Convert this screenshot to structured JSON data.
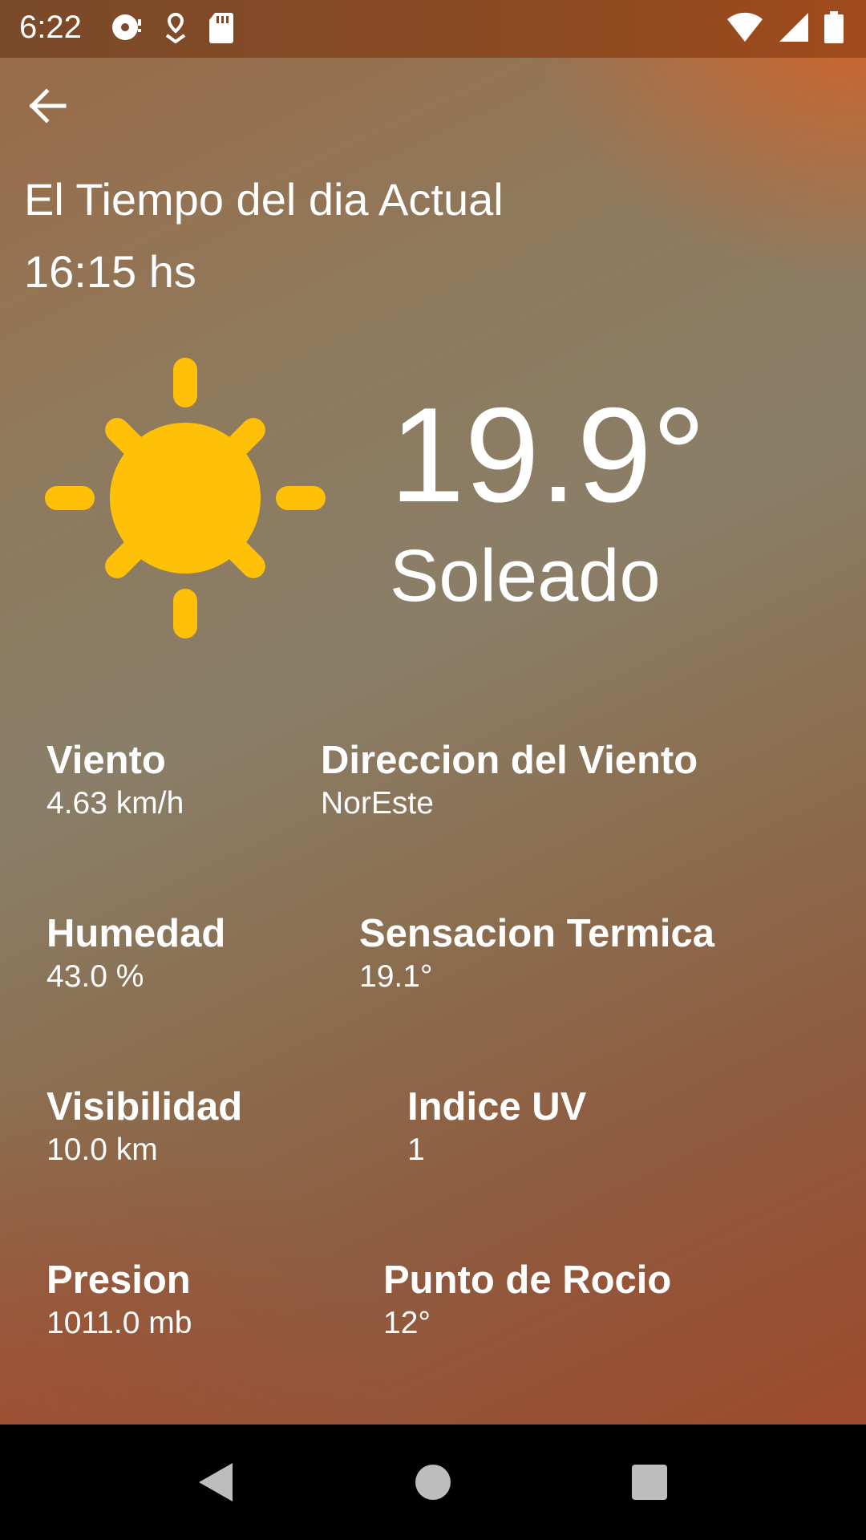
{
  "status_bar": {
    "time": "6:22",
    "left_icons": [
      "disc-icon",
      "location-pin-icon",
      "sd-card-icon"
    ],
    "right_icons": [
      "wifi-icon",
      "signal-icon",
      "battery-icon"
    ]
  },
  "header": {
    "title": "El Tiempo del dia Actual",
    "time": "16:15 hs"
  },
  "current": {
    "icon": "sun-icon",
    "temperature": "19.9°",
    "condition": "Soleado"
  },
  "stats": [
    {
      "label": "Viento",
      "value": "4.63 km/h"
    },
    {
      "label": "Direccion del Viento",
      "value": "NorEste"
    },
    {
      "label": "Humedad",
      "value": "43.0 %"
    },
    {
      "label": "Sensacion Termica",
      "value": "19.1°"
    },
    {
      "label": "Visibilidad",
      "value": "10.0 km"
    },
    {
      "label": "Indice UV",
      "value": "1"
    },
    {
      "label": "Presion",
      "value": "1011.0 mb"
    },
    {
      "label": "Punto de Rocio",
      "value": "12°"
    }
  ],
  "colors": {
    "sun": "#FFC107",
    "accent_top_right": "#E05F1E",
    "text": "#FFFFFF"
  },
  "nav_bar": [
    "back-triangle-icon",
    "home-circle-icon",
    "recents-square-icon"
  ]
}
